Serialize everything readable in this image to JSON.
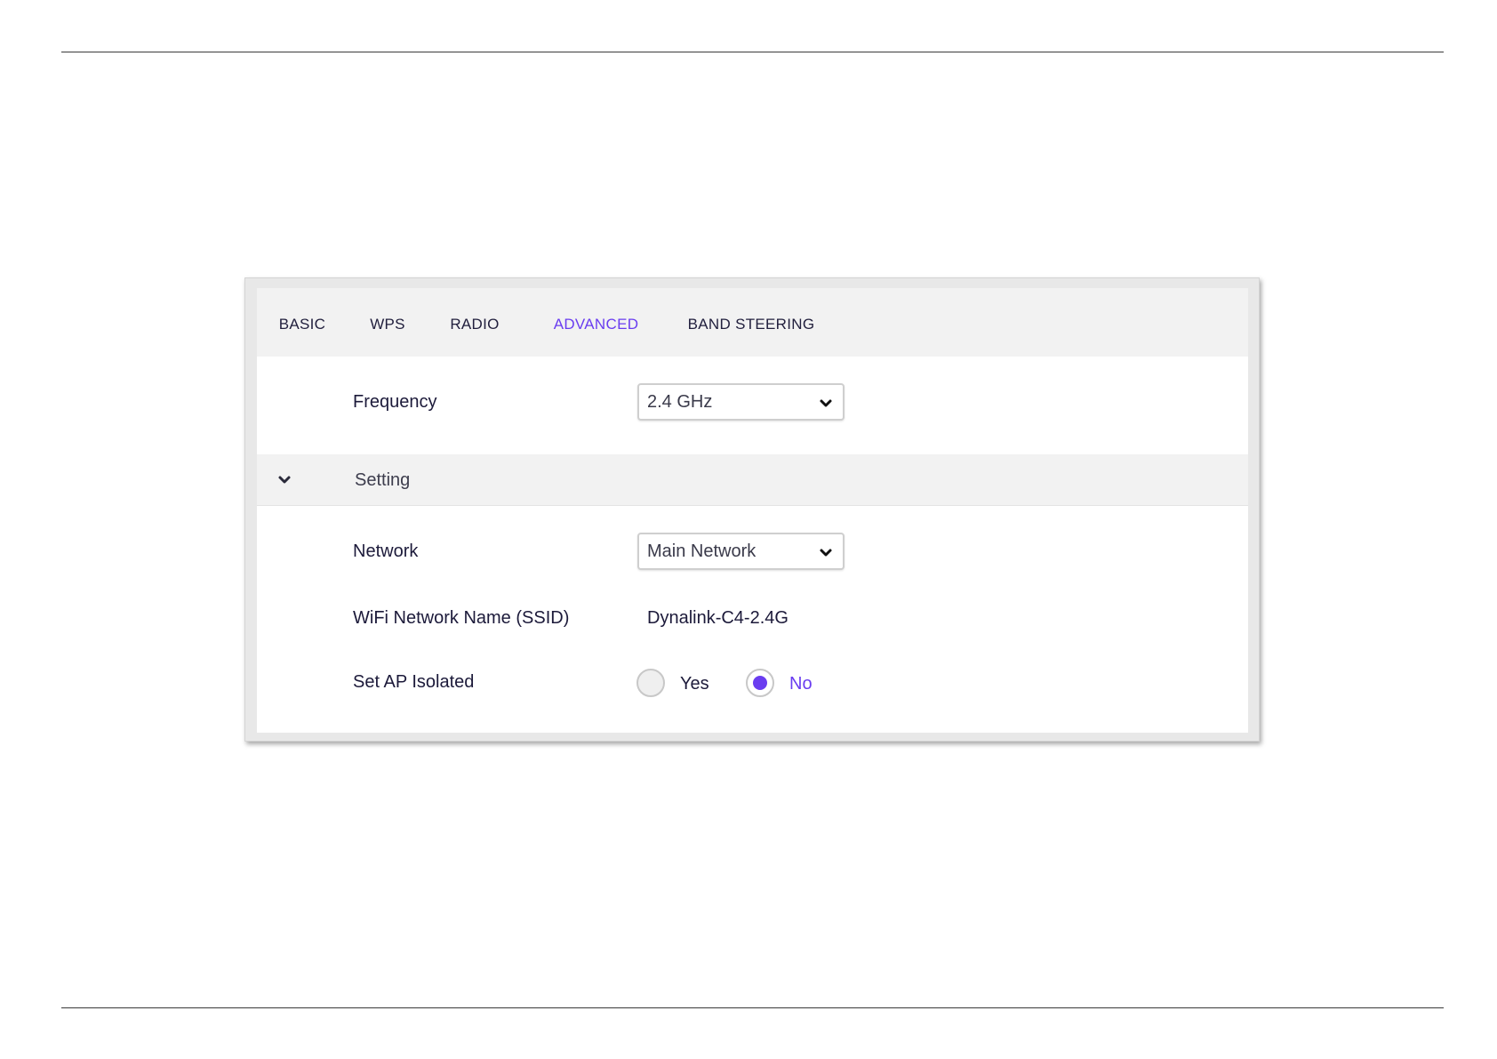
{
  "tabs": [
    {
      "label": "BASIC",
      "active": false
    },
    {
      "label": "WPS",
      "active": false
    },
    {
      "label": "RADIO",
      "active": false
    },
    {
      "label": "ADVANCED",
      "active": true
    },
    {
      "label": "BAND STEERING",
      "active": false
    }
  ],
  "frequency": {
    "label": "Frequency",
    "selected": "2.4 GHz",
    "icon": "chevron-down-icon"
  },
  "section": {
    "title": "Setting",
    "icon": "chevron-down-icon",
    "expanded": true
  },
  "network": {
    "label": "Network",
    "selected": "Main Network",
    "icon": "chevron-down-icon"
  },
  "ssid": {
    "label": "WiFi Network Name (SSID)",
    "value": "Dynalink-C4-2.4G"
  },
  "ap_isolated": {
    "label": "Set AP Isolated",
    "options": [
      {
        "label": "Yes",
        "selected": false
      },
      {
        "label": "No",
        "selected": true
      }
    ]
  },
  "colors": {
    "accent": "#6a3df0",
    "text": "#1c1a3a",
    "panel_bg": "#f2f2f2"
  }
}
